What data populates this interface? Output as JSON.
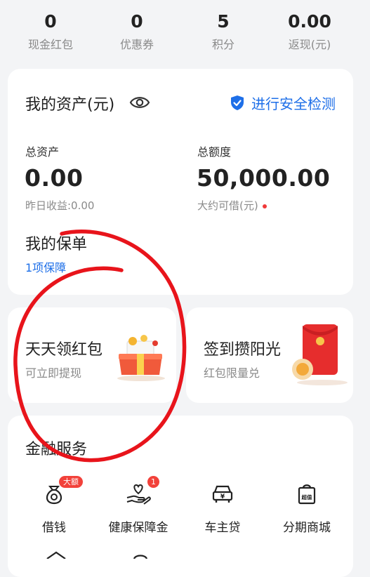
{
  "stats": [
    {
      "value": "0",
      "label": "现金红包"
    },
    {
      "value": "0",
      "label": "优惠券"
    },
    {
      "value": "5",
      "label": "积分"
    },
    {
      "value": "0.00",
      "label": "返现(元)"
    }
  ],
  "assets": {
    "title": "我的资产(元)",
    "safety_link": "进行安全检测",
    "total_assets_label": "总资产",
    "total_assets_value": "0.00",
    "yesterday_income": "昨日收益:0.00",
    "credit_label": "总额度",
    "credit_value": "50,000.00",
    "borrowable": "大约可借(元)",
    "policy_title": "我的保单",
    "policy_link": "1项保障"
  },
  "promos": [
    {
      "title": "天天领红包",
      "subtitle": "可立即提现"
    },
    {
      "title": "签到攒阳光",
      "subtitle": "红包限量兑"
    }
  ],
  "finance": {
    "title": "金融服务",
    "services": [
      {
        "label": "借钱",
        "badge": "大额",
        "icon": "money-bag-icon"
      },
      {
        "label": "健康保障金",
        "badge": "1",
        "icon": "heart-hand-icon"
      },
      {
        "label": "车主贷",
        "badge": "",
        "icon": "car-loan-icon"
      },
      {
        "label": "分期商城",
        "badge": "",
        "icon": "shopping-bag-icon"
      }
    ],
    "icon_glyphs": {
      "car": "¥",
      "mall": "超值"
    }
  },
  "colors": {
    "accent_blue": "#1e6fe8",
    "badge_red": "#f2413a",
    "annotation_red": "#e8141b"
  }
}
